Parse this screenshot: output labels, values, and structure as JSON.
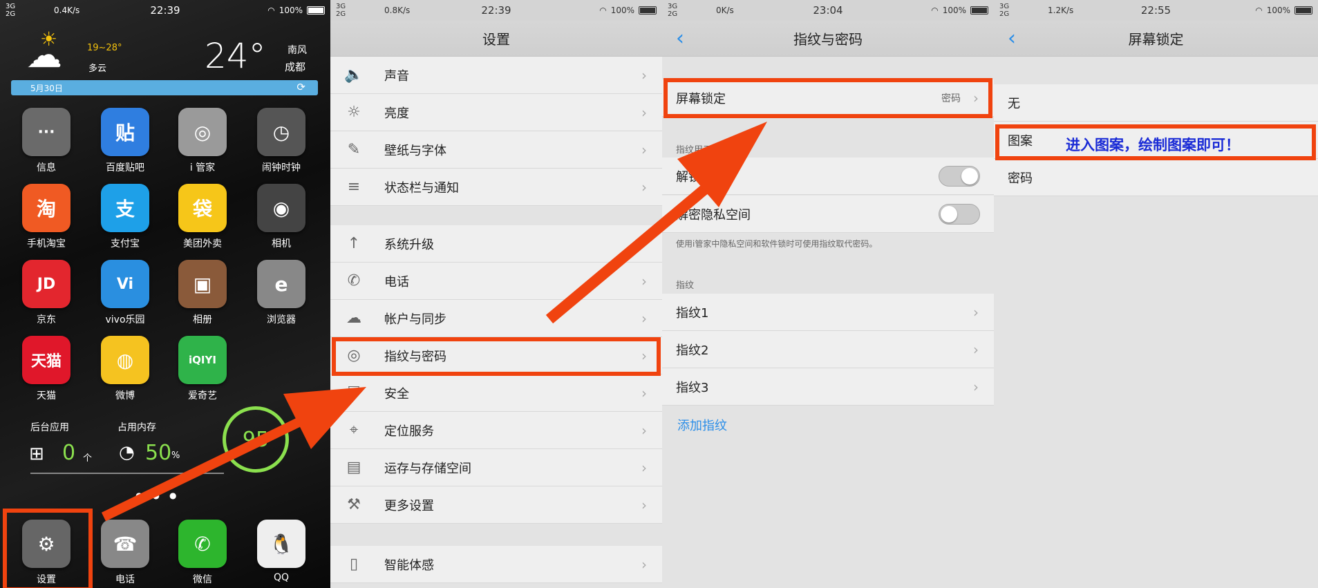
{
  "panel1": {
    "status": {
      "sig": "3Gᴵᴵᴵ 2G",
      "net": "0.4K/s",
      "time": "22:39",
      "battery": "100%"
    },
    "weather": {
      "temp_range": "19~28°",
      "condition": "多云",
      "temp": "24°",
      "wind": "南风",
      "city": "成都",
      "date": "5月30日"
    },
    "apps": [
      {
        "label": "信息",
        "glyph": "···",
        "color": "#6a6a6a"
      },
      {
        "label": "百度贴吧",
        "glyph": "贴",
        "color": "#2f7ee0"
      },
      {
        "label": "i 管家",
        "glyph": "◎",
        "color": "#9a9a9a"
      },
      {
        "label": "闹钟时钟",
        "glyph": "◷",
        "color": "#555"
      },
      {
        "label": "手机淘宝",
        "glyph": "淘",
        "color": "#f05a23"
      },
      {
        "label": "支付宝",
        "glyph": "支",
        "color": "#1ea0e8"
      },
      {
        "label": "美团外卖",
        "glyph": "袋",
        "color": "#f6c619"
      },
      {
        "label": "相机",
        "glyph": "◉",
        "color": "#444"
      },
      {
        "label": "京东",
        "glyph": "JD",
        "color": "#e3262e"
      },
      {
        "label": "vivo乐园",
        "glyph": "Vi",
        "color": "#2a8fe0"
      },
      {
        "label": "相册",
        "glyph": "▣",
        "color": "#8a5a3a"
      },
      {
        "label": "浏览器",
        "glyph": "e",
        "color": "#888"
      },
      {
        "label": "天猫",
        "glyph": "天猫",
        "color": "#e0172a"
      },
      {
        "label": "微博",
        "glyph": "◍",
        "color": "#f5c320"
      },
      {
        "label": "爱奇艺",
        "glyph": "iQIYI",
        "color": "#2fb34a"
      }
    ],
    "stats": {
      "bg_label": "后台应用",
      "bg_value": "0",
      "bg_unit": "个",
      "mem_label": "占用内存",
      "mem_value": "50",
      "mem_unit": "%",
      "score": "95"
    },
    "dock": [
      {
        "label": "设置",
        "glyph": "⚙",
        "color": "#666"
      },
      {
        "label": "电话",
        "glyph": "☎",
        "color": "#888"
      },
      {
        "label": "微信",
        "glyph": "✆",
        "color": "#2db52d"
      },
      {
        "label": "QQ",
        "glyph": "🐧",
        "color": "#eee"
      }
    ]
  },
  "panel2": {
    "status": {
      "net": "0.8K/s",
      "time": "22:39",
      "battery": "100%"
    },
    "title": "设置",
    "group1": [
      {
        "label": "声音",
        "icon": "speaker-icon",
        "glyph": "🔈"
      },
      {
        "label": "亮度",
        "icon": "sun-icon",
        "glyph": "☼"
      },
      {
        "label": "壁纸与字体",
        "icon": "brush-icon",
        "glyph": "✎"
      },
      {
        "label": "状态栏与通知",
        "icon": "list-icon",
        "glyph": "≡"
      }
    ],
    "group2": [
      {
        "label": "系统升级",
        "icon": "arrow-up-icon",
        "glyph": "↑"
      },
      {
        "label": "电话",
        "icon": "phone-icon",
        "glyph": "✆"
      },
      {
        "label": "帐户与同步",
        "icon": "cloud-icon",
        "glyph": "☁"
      },
      {
        "label": "指纹与密码",
        "icon": "fingerprint-icon",
        "glyph": "◎"
      },
      {
        "label": "安全",
        "icon": "shield-icon",
        "glyph": "⛨"
      },
      {
        "label": "定位服务",
        "icon": "location-icon",
        "glyph": "⌖"
      },
      {
        "label": "运存与存储空间",
        "icon": "sdcard-icon",
        "glyph": "▤"
      },
      {
        "label": "更多设置",
        "icon": "wrench-icon",
        "glyph": "⚒"
      }
    ],
    "group3": [
      {
        "label": "智能体感",
        "icon": "phone-motion-icon",
        "glyph": "▯"
      }
    ]
  },
  "panel3": {
    "status": {
      "net": "0K/s",
      "time": "23:04",
      "battery": "100%"
    },
    "title": "指纹与密码",
    "screen_lock": {
      "label": "屏幕锁定",
      "value": "密码"
    },
    "section_fp_use": "指纹用于",
    "unlock_label": "解锁",
    "privacy_label": "解密隐私空间",
    "hint": "使用i管家中隐私空间和软件锁时可使用指纹取代密码。",
    "section_fp": "指纹",
    "fingerprints": [
      "指纹1",
      "指纹2",
      "指纹3"
    ],
    "add_fp": "添加指纹"
  },
  "panel4": {
    "status": {
      "net": "1.2K/s",
      "time": "22:55",
      "battery": "100%"
    },
    "title": "屏幕锁定",
    "options": [
      "无",
      "图案",
      "密码"
    ],
    "annotation": "进入图案，绘制图案即可！"
  },
  "colors": {
    "accent": "#2b8ee8",
    "highlight": "#f0430f",
    "annotation": "#1a2bd6"
  }
}
